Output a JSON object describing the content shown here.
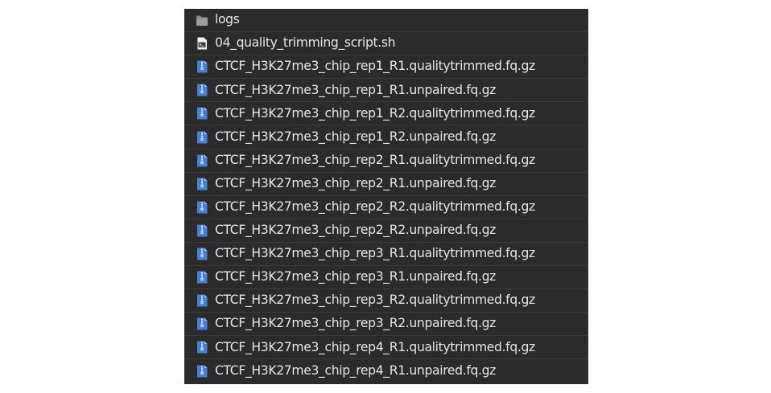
{
  "colors": {
    "panel_background": "#2b2b2b",
    "row_divider": "#3a3a3a",
    "text": "#e4e4e4",
    "folder_icon": "#8a8a8a",
    "archive_icon": "#4a7fd6"
  },
  "files": [
    {
      "name": "logs",
      "icon": "folder-icon"
    },
    {
      "name": "04_quality_trimming_script.sh",
      "icon": "script-file-icon"
    },
    {
      "name": "CTCF_H3K27me3_chip_rep1_R1.qualitytrimmed.fq.gz",
      "icon": "archive-file-icon"
    },
    {
      "name": "CTCF_H3K27me3_chip_rep1_R1.unpaired.fq.gz",
      "icon": "archive-file-icon"
    },
    {
      "name": "CTCF_H3K27me3_chip_rep1_R2.qualitytrimmed.fq.gz",
      "icon": "archive-file-icon"
    },
    {
      "name": "CTCF_H3K27me3_chip_rep1_R2.unpaired.fq.gz",
      "icon": "archive-file-icon"
    },
    {
      "name": "CTCF_H3K27me3_chip_rep2_R1.qualitytrimmed.fq.gz",
      "icon": "archive-file-icon"
    },
    {
      "name": "CTCF_H3K27me3_chip_rep2_R1.unpaired.fq.gz",
      "icon": "archive-file-icon"
    },
    {
      "name": "CTCF_H3K27me3_chip_rep2_R2.qualitytrimmed.fq.gz",
      "icon": "archive-file-icon"
    },
    {
      "name": "CTCF_H3K27me3_chip_rep2_R2.unpaired.fq.gz",
      "icon": "archive-file-icon"
    },
    {
      "name": "CTCF_H3K27me3_chip_rep3_R1.qualitytrimmed.fq.gz",
      "icon": "archive-file-icon"
    },
    {
      "name": "CTCF_H3K27me3_chip_rep3_R1.unpaired.fq.gz",
      "icon": "archive-file-icon"
    },
    {
      "name": "CTCF_H3K27me3_chip_rep3_R2.qualitytrimmed.fq.gz",
      "icon": "archive-file-icon"
    },
    {
      "name": "CTCF_H3K27me3_chip_rep3_R2.unpaired.fq.gz",
      "icon": "archive-file-icon"
    },
    {
      "name": "CTCF_H3K27me3_chip_rep4_R1.qualitytrimmed.fq.gz",
      "icon": "archive-file-icon"
    },
    {
      "name": "CTCF_H3K27me3_chip_rep4_R1.unpaired.fq.gz",
      "icon": "archive-file-icon"
    }
  ]
}
